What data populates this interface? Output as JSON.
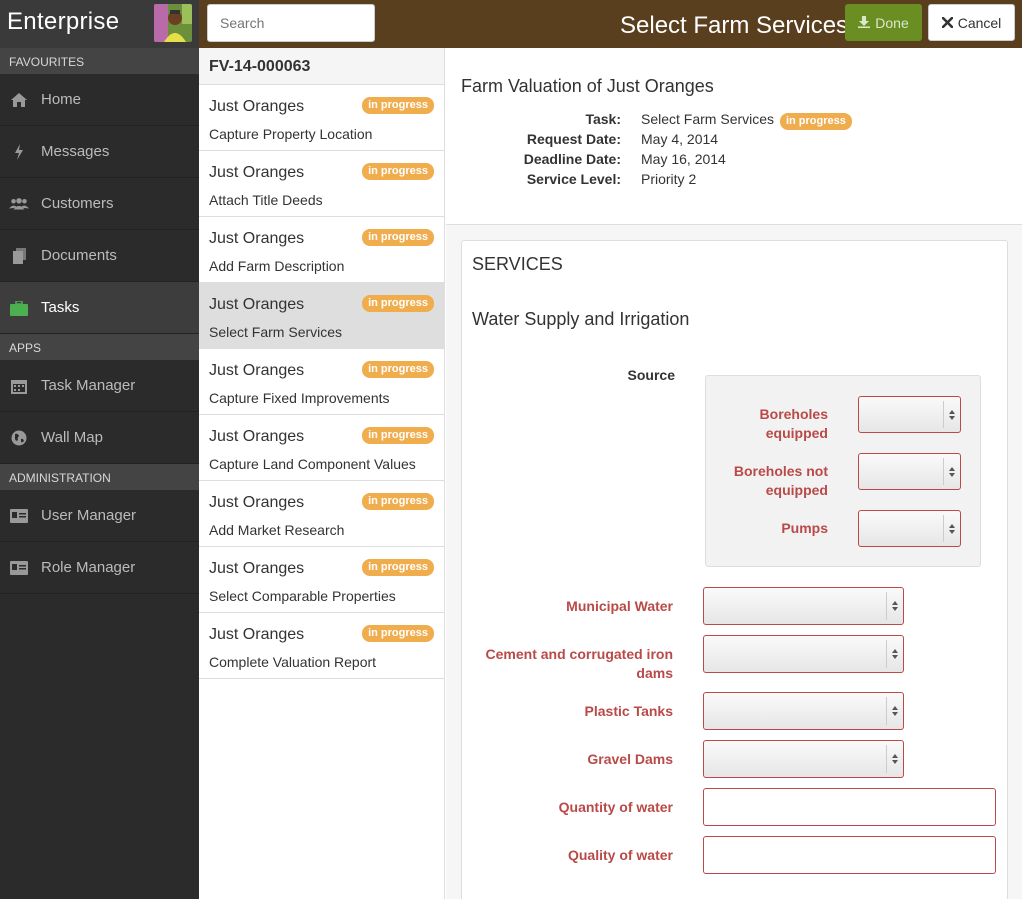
{
  "sidebar": {
    "brand": "Enterprise",
    "sections": [
      {
        "label": "FAVOURITES"
      },
      {
        "label": "APPS"
      },
      {
        "label": "ADMINISTRATION"
      }
    ],
    "items": [
      {
        "label": "Home",
        "icon": "home-icon"
      },
      {
        "label": "Messages",
        "icon": "bolt-icon"
      },
      {
        "label": "Customers",
        "icon": "users-icon"
      },
      {
        "label": "Documents",
        "icon": "documents-icon"
      },
      {
        "label": "Tasks",
        "icon": "briefcase-icon",
        "active": true
      },
      {
        "label": "Task Manager",
        "icon": "calendar-icon"
      },
      {
        "label": "Wall Map",
        "icon": "globe-icon"
      },
      {
        "label": "User Manager",
        "icon": "id-card-icon"
      },
      {
        "label": "Role Manager",
        "icon": "id-card-icon"
      }
    ]
  },
  "topbar": {
    "search_placeholder": "Search",
    "title": "Select Farm Services",
    "done_label": "Done",
    "cancel_label": "Cancel",
    "bar_color": "#5a3f1e",
    "done_color": "#6b8e23"
  },
  "tasklist": {
    "header": "FV-14-000063",
    "badge_text": "in progress",
    "badge_color": "#f0ad4e",
    "tasks": [
      {
        "name": "Just Oranges",
        "step": "Capture Property Location"
      },
      {
        "name": "Just Oranges",
        "step": "Attach Title Deeds"
      },
      {
        "name": "Just Oranges",
        "step": "Add Farm Description"
      },
      {
        "name": "Just Oranges",
        "step": "Select Farm Services",
        "active": true
      },
      {
        "name": "Just Oranges",
        "step": "Capture Fixed Improvements"
      },
      {
        "name": "Just Oranges",
        "step": "Capture Land Component Values"
      },
      {
        "name": "Just Oranges",
        "step": "Add Market Research"
      },
      {
        "name": "Just Oranges",
        "step": "Select Comparable Properties"
      },
      {
        "name": "Just Oranges",
        "step": "Complete Valuation Report"
      }
    ]
  },
  "detail": {
    "title": "Farm Valuation of Just Oranges",
    "task_key": "Task:",
    "task_val": "Select Farm Services",
    "task_badge": "in progress",
    "request_key": "Request Date:",
    "request_val": "May 4, 2014",
    "deadline_key": "Deadline Date:",
    "deadline_val": "May 16, 2014",
    "service_key": "Service Level:",
    "service_val": "Priority 2"
  },
  "services": {
    "heading": "SERVICES",
    "subheading": "Water Supply and Irrigation",
    "source_label": "Source",
    "source_fields": [
      {
        "label_line1": "Boreholes",
        "label_line2": "equipped"
      },
      {
        "label_line1": "Boreholes not",
        "label_line2": "equipped"
      },
      {
        "label_line1": "Pumps",
        "label_line2": ""
      }
    ],
    "fields": [
      {
        "label_line1": "Municipal Water",
        "label_line2": "",
        "type": "select"
      },
      {
        "label_line1": "Cement and corrugated iron",
        "label_line2": "dams",
        "type": "select"
      },
      {
        "label_line1": "Plastic Tanks",
        "label_line2": "",
        "type": "select"
      },
      {
        "label_line1": "Gravel Dams",
        "label_line2": "",
        "type": "select"
      },
      {
        "label_line1": "Quantity of water",
        "label_line2": "",
        "type": "text"
      },
      {
        "label_line1": "Quality of water",
        "label_line2": "",
        "type": "text"
      }
    ],
    "error_color": "#b94a48"
  }
}
